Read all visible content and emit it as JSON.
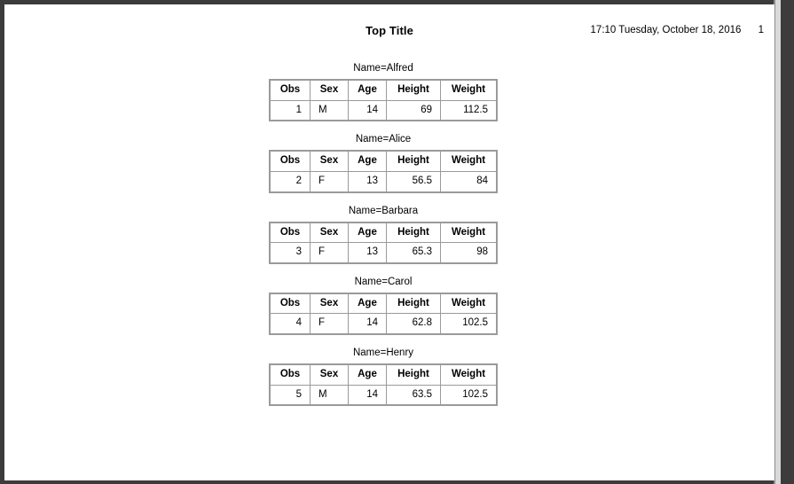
{
  "header": {
    "title": "Top Title",
    "timestamp": "17:10 Tuesday, October 18, 2016",
    "page_number": "1"
  },
  "table": {
    "columns": [
      "Obs",
      "Sex",
      "Age",
      "Height",
      "Weight"
    ]
  },
  "bygroups": [
    {
      "label": "Name=Alfred",
      "row": {
        "obs": "1",
        "sex": "M",
        "age": "14",
        "height": "69",
        "weight": "112.5"
      }
    },
    {
      "label": "Name=Alice",
      "row": {
        "obs": "2",
        "sex": "F",
        "age": "13",
        "height": "56.5",
        "weight": "84"
      }
    },
    {
      "label": "Name=Barbara",
      "row": {
        "obs": "3",
        "sex": "F",
        "age": "13",
        "height": "65.3",
        "weight": "98"
      }
    },
    {
      "label": "Name=Carol",
      "row": {
        "obs": "4",
        "sex": "F",
        "age": "14",
        "height": "62.8",
        "weight": "102.5"
      }
    },
    {
      "label": "Name=Henry",
      "row": {
        "obs": "5",
        "sex": "M",
        "age": "14",
        "height": "63.5",
        "weight": "102.5"
      }
    }
  ],
  "colors": {
    "frame": "#3c3c3c",
    "table_border": "#9a9a9a",
    "text": "#000000",
    "page_background": "#ffffff"
  }
}
